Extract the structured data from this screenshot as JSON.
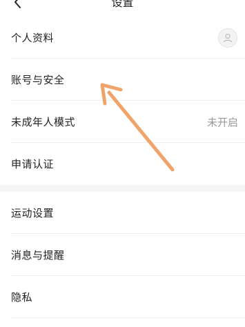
{
  "header": {
    "title": "设置",
    "back_icon": "chevron-left-icon"
  },
  "group1": [
    {
      "label": "个人资料",
      "trailing": "avatar"
    },
    {
      "label": "账号与安全",
      "trailing": ""
    },
    {
      "label": "未成年人模式",
      "value": "未开启"
    },
    {
      "label": "申请认证",
      "trailing": ""
    }
  ],
  "group2": [
    {
      "label": "运动设置"
    },
    {
      "label": "消息与提醒"
    },
    {
      "label": "隐私"
    }
  ],
  "annotation": {
    "type": "arrow",
    "color": "#f0a46a",
    "icon": "annotation-arrow-icon"
  }
}
